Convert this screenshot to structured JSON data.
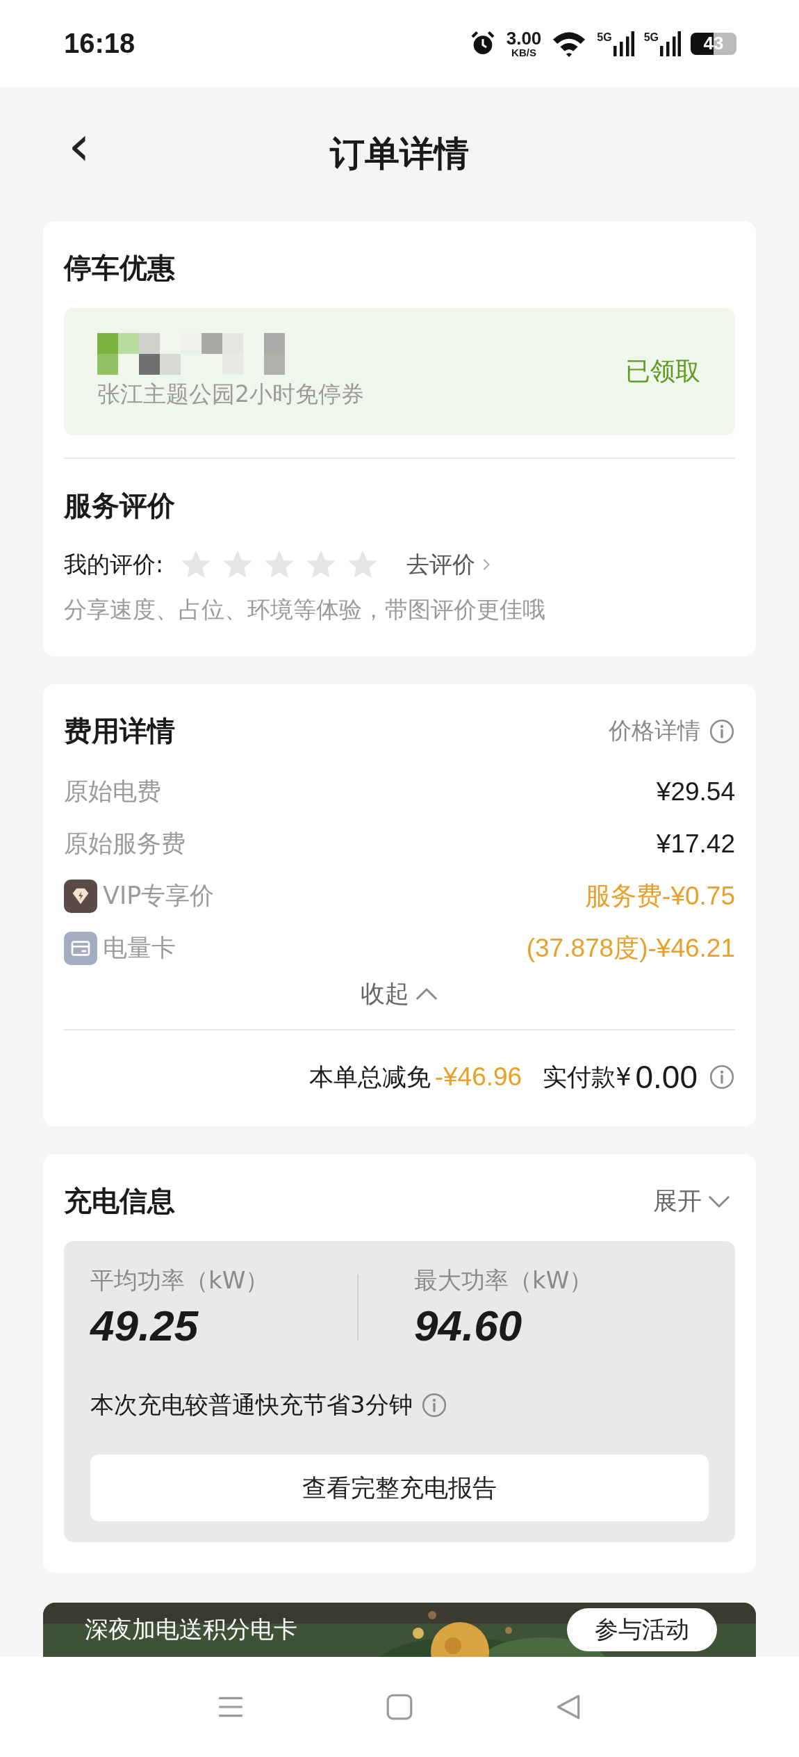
{
  "status_bar": {
    "time": "16:18",
    "speed": "3.00",
    "speed_unit": "KB/S",
    "sim_labels": [
      "5G",
      "5G"
    ],
    "battery": "43"
  },
  "header": {
    "back": "‹",
    "title": "订单详情"
  },
  "parking": {
    "title": "停车优惠",
    "coupon": {
      "kind": "picture",
      "name": "张江主题公园2小时免停券",
      "status": "已领取"
    }
  },
  "review": {
    "title": "服务评价",
    "label": "我的评价:",
    "stars": 0,
    "action": "去评价",
    "hint": "分享速度、占位、环境等体验，带图评价更佳哦"
  },
  "fees": {
    "title": "费用详情",
    "price_link": "价格详情",
    "expanded": true,
    "toggle": "收起",
    "rows": [
      {
        "kind": "plain",
        "label": "原始电费",
        "value": "¥29.54"
      },
      {
        "kind": "plain",
        "label": "原始服务费",
        "value": "¥17.42"
      },
      {
        "kind": "vip",
        "label": "VIP专享价",
        "value": "服务费-¥0.75"
      },
      {
        "kind": "card",
        "label": "电量卡",
        "value": "(37.878度)-¥46.21"
      }
    ],
    "discount_label": "本单总减免",
    "discount": "-¥46.96",
    "paid_label": "实付款¥",
    "paid": "0.00"
  },
  "charging": {
    "title": "充电信息",
    "toggle": "展开",
    "expanded": false,
    "stats": [
      {
        "label": "平均功率（kW）",
        "value": "49.25"
      },
      {
        "label": "最大功率（kW）",
        "value": "94.60"
      }
    ],
    "note": "本次充电较普通快充节省3分钟",
    "button": "查看完整充电报告"
  },
  "banner": {
    "text": "深夜加电送积分电卡",
    "button": "参与活动"
  }
}
